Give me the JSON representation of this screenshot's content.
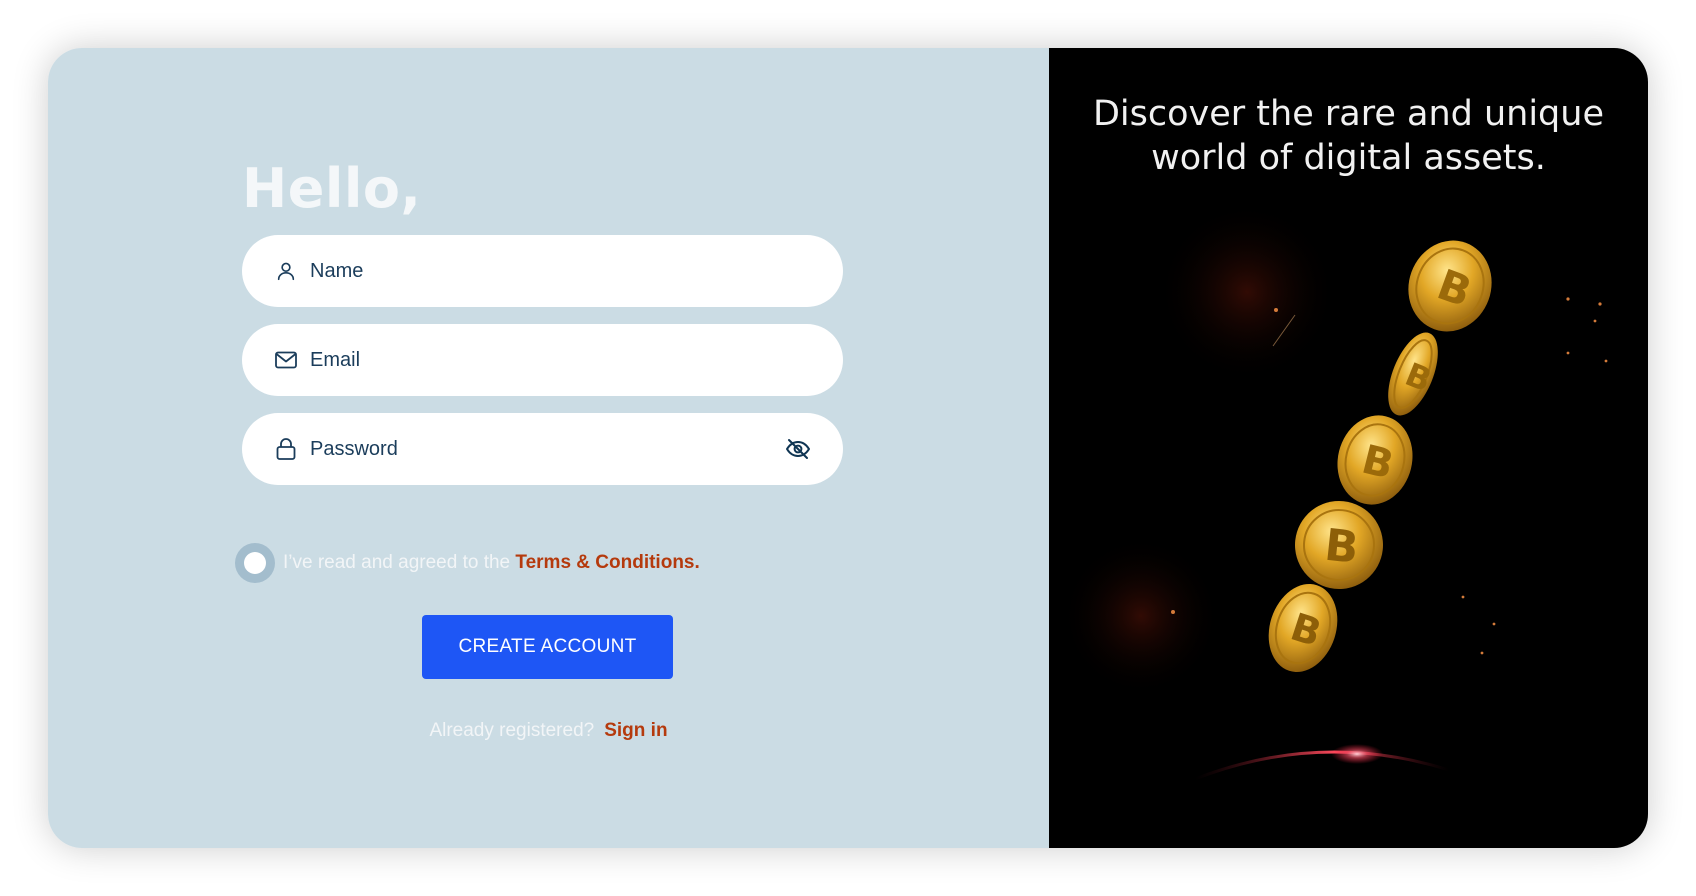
{
  "greeting": "Hello,",
  "form": {
    "name_placeholder": "Name",
    "email_placeholder": "Email",
    "password_placeholder": "Password",
    "name_value": "",
    "email_value": "",
    "password_value": ""
  },
  "terms": {
    "prefix": "I’ve read and agreed to the ",
    "link": "Terms & Conditions."
  },
  "cta_label": "CREATE ACCOUNT",
  "signin": {
    "prompt": "Already registered?",
    "link": "Sign in"
  },
  "promo": {
    "line1": "Discover the rare and unique",
    "line2": "world of digital assets."
  },
  "colors": {
    "left_panel": "#cbdce4",
    "right_panel": "#000000",
    "primary": "#1e56f5",
    "accent_link": "#b53a0d",
    "input_text": "#1b3d5b"
  },
  "icons": {
    "name": "user-icon",
    "email": "mail-icon",
    "password": "lock-icon",
    "visibility": "eye-off-icon"
  }
}
